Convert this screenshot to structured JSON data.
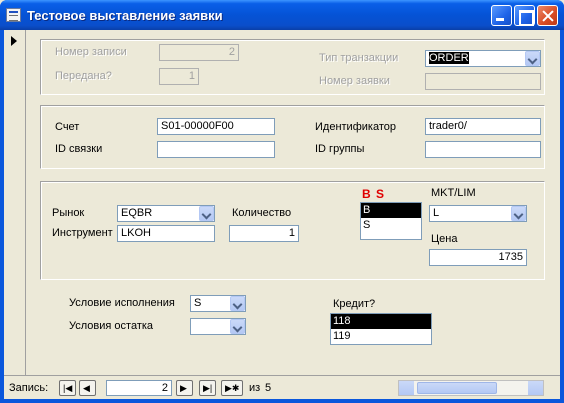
{
  "window": {
    "title": "Тестовое выставление заявки"
  },
  "record_section": {
    "record_no_label": "Номер записи",
    "record_no": "2",
    "sent_label": "Передана?",
    "sent": "1",
    "txn_type_label": "Тип транзакции",
    "txn_type": "ORDER",
    "order_no_label": "Номер заявки",
    "order_no": ""
  },
  "account_section": {
    "account_label": "Счет",
    "account": "S01-00000F00",
    "id_label": "Идентификатор",
    "id": "trader0/",
    "link_id_label": "ID связки",
    "link_id": "",
    "group_id_label": "ID группы",
    "group_id": ""
  },
  "order_section": {
    "market_label": "Рынок",
    "market": "EQBR",
    "quantity_label": "Количество",
    "quantity": "1",
    "instrument_label": "Инструмент",
    "instrument": "LKOH",
    "bs_label": "B S",
    "bs_options": [
      "B",
      "S"
    ],
    "bs_selected": "B",
    "mktlim_label": "MKT/LIM",
    "mktlim": "L",
    "price_label": "Цена",
    "price": "1735"
  },
  "execution": {
    "condition_label": "Условие исполнения",
    "condition": "S",
    "remainder_label": "Условия остатка",
    "remainder": "",
    "credit_label": "Кредит?",
    "credit_options": [
      "118",
      "119"
    ],
    "credit_selected": "118"
  },
  "navigation": {
    "record_label": "Запись:",
    "current": "2",
    "of_label": "из",
    "total": "5"
  },
  "colors": {
    "titlebar": "#0553d6",
    "bs_label": "#e00000",
    "selection": "#000000"
  }
}
